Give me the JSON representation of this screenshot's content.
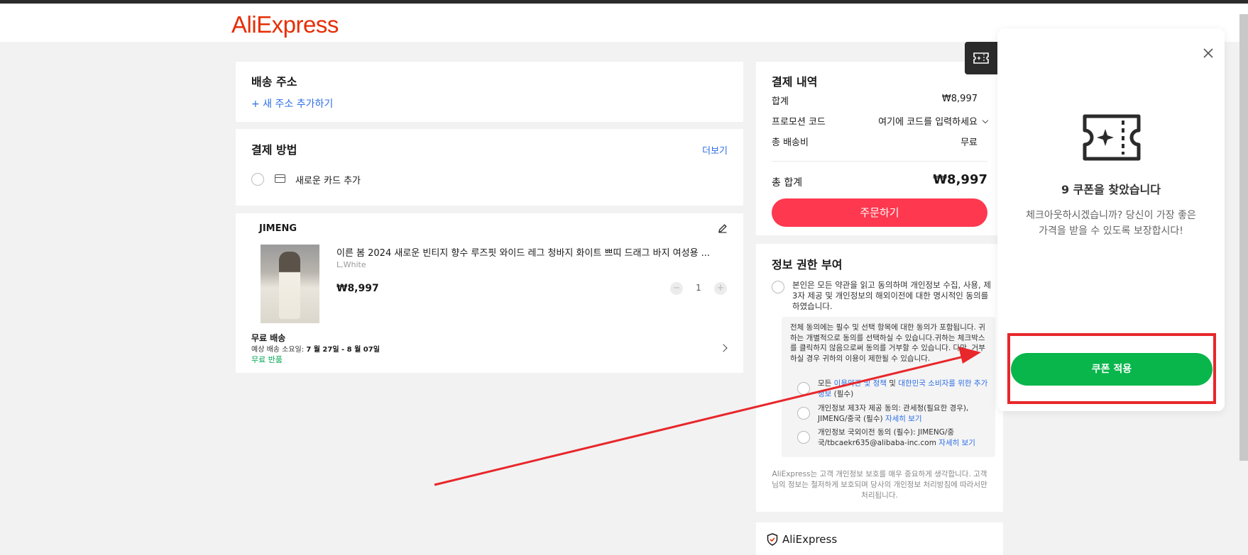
{
  "header": {
    "logo": "AliExpress"
  },
  "address": {
    "title": "배송 주소",
    "add_link": "+ 새 주소 추가하기"
  },
  "payment": {
    "title": "결제 방법",
    "more_link": "더보기",
    "new_card": "새로운 카드 추가"
  },
  "product": {
    "seller": "JIMENG",
    "title": "이른 봄 2024 새로운 빈티지 향수 루즈핏 와이드 레그 청바지 화이트 쁘띠 드래그 바지 여성용 ...",
    "variant": "L,White",
    "price": "₩8,997",
    "quantity": "1",
    "minus": "−",
    "plus": "+",
    "shipping_title": "무료 배송",
    "eta_label": "예상 배송 소요일: ",
    "eta_value": "7 월 27일 - 8 월 07일",
    "returns": "무료 반품"
  },
  "summary": {
    "title": "결제 내역",
    "subtotal_label": "합계",
    "subtotal_value": "₩8,997",
    "promo_label": "프로모션 코드",
    "promo_placeholder": "여기에 코드를 입력하세요",
    "shipping_label": "총 배송비",
    "shipping_value": "무료",
    "total_label": "총 합계",
    "total_value": "₩8,997",
    "order_button": "주문하기"
  },
  "consent": {
    "title": "정보 권한 부여",
    "main_text": "본인은 모든 약관을 읽고 동의하며 개인정보 수집, 사용, 제3자 제공 및 개인정보의 해외이전에 대한 명시적인 동의를 하였습니다.",
    "box_desc": "전체 동의에는 필수 및 선택 항목에 대한 동의가 포함됩니다. 귀하는 개별적으로 동의를 선택하실 수 있습니다.귀하는 체크박스를 클릭하지 않음으로써 동의를 거부할 수 있습니다. 다만, 거부하실 경우 귀하의 이용이 제한될 수 있습니다.",
    "item1_a": "모든 ",
    "item1_link1": "이용약관 및 정책",
    "item1_b": " 및 ",
    "item1_link2": "대한민국 소비자를 위한 추가 정보",
    "item1_c": " (필수)",
    "item2_text": "개인정보 제3자 제공 동의: 관세청(필요한 경우), JIMENG/중국 (필수) ",
    "item2_link": "자세히 보기",
    "item3_text": "개인정보 국외이전 동의 (필수): JIMENG/중국/tbcaekr635@alibaba-inc.com ",
    "item3_link": "자세히 보기",
    "footer": "AliExpress는 고객 개인정보 보호를 매우 중요하게 생각합니다. 고객님의 정보는 철저하게 보호되며 당사의 개인정보 처리방침에 따라서만 처리됩니다."
  },
  "trust": {
    "logo": "AliExpress"
  },
  "coupon_panel": {
    "title": "9 쿠폰을 찾았습니다",
    "text": "체크아웃하시겠습니까? 당신이 가장 좋은 가격을 받을 수 있도록 보장합시다!",
    "apply_button": "쿠폰 적용"
  },
  "colors": {
    "brand": "#e62e04",
    "order_button": "#fd384f",
    "apply_button": "#08b64b",
    "link": "#2d6ee6",
    "annotation": "#e8272b"
  },
  "icons": [
    "plus-icon",
    "card-icon",
    "edit-icon",
    "chevron-right-icon",
    "chevron-down-icon",
    "ticket-icon",
    "close-icon",
    "shield-icon"
  ]
}
